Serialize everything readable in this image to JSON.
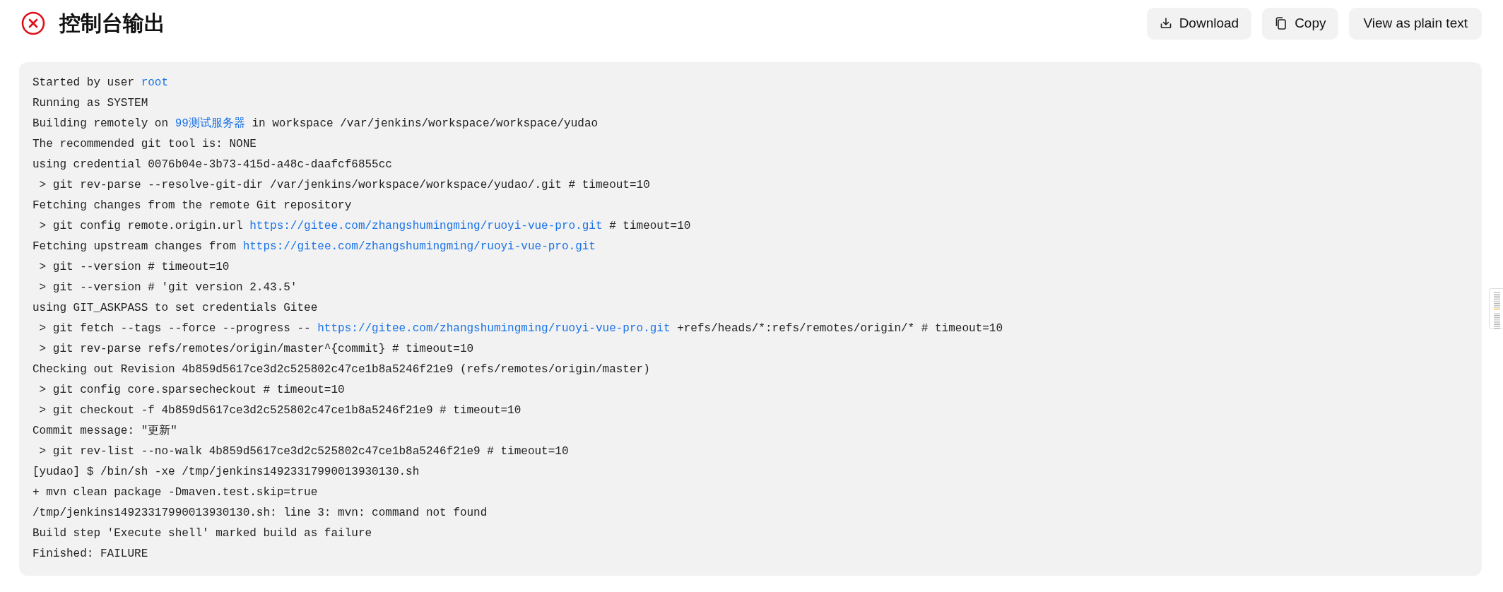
{
  "header": {
    "failed": true,
    "title": "控制台输出"
  },
  "buttons": [
    {
      "kind": "download",
      "label": "Download"
    },
    {
      "kind": "copy",
      "label": "Copy"
    },
    {
      "kind": "plain",
      "label": "View as plain text"
    }
  ],
  "log": [
    [
      {
        "kind": "text",
        "text": "Started by user "
      },
      {
        "kind": "link",
        "text": "root"
      }
    ],
    [
      {
        "kind": "text",
        "text": "Running as SYSTEM"
      }
    ],
    [
      {
        "kind": "text",
        "text": "Building remotely on "
      },
      {
        "kind": "link",
        "text": "99测试服务器"
      },
      {
        "kind": "text",
        "text": " in workspace /var/jenkins/workspace/workspace/yudao"
      }
    ],
    [
      {
        "kind": "text",
        "text": "The recommended git tool is: NONE"
      }
    ],
    [
      {
        "kind": "text",
        "text": "using credential 0076b04e-3b73-415d-a48c-daafcf6855cc"
      }
    ],
    [
      {
        "kind": "text",
        "text": " > git rev-parse --resolve-git-dir /var/jenkins/workspace/workspace/yudao/.git # timeout=10"
      }
    ],
    [
      {
        "kind": "text",
        "text": "Fetching changes from the remote Git repository"
      }
    ],
    [
      {
        "kind": "text",
        "text": " > git config remote.origin.url "
      },
      {
        "kind": "link",
        "text": "https://gitee.com/zhangshumingming/ruoyi-vue-pro.git"
      },
      {
        "kind": "text",
        "text": " # timeout=10"
      }
    ],
    [
      {
        "kind": "text",
        "text": "Fetching upstream changes from "
      },
      {
        "kind": "link",
        "text": "https://gitee.com/zhangshumingming/ruoyi-vue-pro.git"
      }
    ],
    [
      {
        "kind": "text",
        "text": " > git --version # timeout=10"
      }
    ],
    [
      {
        "kind": "text",
        "text": " > git --version # 'git version 2.43.5'"
      }
    ],
    [
      {
        "kind": "text",
        "text": "using GIT_ASKPASS to set credentials Gitee"
      }
    ],
    [
      {
        "kind": "text",
        "text": " > git fetch --tags --force --progress -- "
      },
      {
        "kind": "link",
        "text": "https://gitee.com/zhangshumingming/ruoyi-vue-pro.git"
      },
      {
        "kind": "text",
        "text": " +refs/heads/*:refs/remotes/origin/* # timeout=10"
      }
    ],
    [
      {
        "kind": "text",
        "text": " > git rev-parse refs/remotes/origin/master^{commit} # timeout=10"
      }
    ],
    [
      {
        "kind": "text",
        "text": "Checking out Revision 4b859d5617ce3d2c525802c47ce1b8a5246f21e9 (refs/remotes/origin/master)"
      }
    ],
    [
      {
        "kind": "text",
        "text": " > git config core.sparsecheckout # timeout=10"
      }
    ],
    [
      {
        "kind": "text",
        "text": " > git checkout -f 4b859d5617ce3d2c525802c47ce1b8a5246f21e9 # timeout=10"
      }
    ],
    [
      {
        "kind": "text",
        "text": "Commit message: \"更新\""
      }
    ],
    [
      {
        "kind": "text",
        "text": " > git rev-list --no-walk 4b859d5617ce3d2c525802c47ce1b8a5246f21e9 # timeout=10"
      }
    ],
    [
      {
        "kind": "text",
        "text": "[yudao] $ /bin/sh -xe /tmp/jenkins14923317990013930130.sh"
      }
    ],
    [
      {
        "kind": "text",
        "text": "+ mvn clean package -Dmaven.test.skip=true"
      }
    ],
    [
      {
        "kind": "text",
        "text": "/tmp/jenkins14923317990013930130.sh: line 3: mvn: command not found"
      }
    ],
    [
      {
        "kind": "text",
        "text": "Build step 'Execute shell' marked build as failure"
      }
    ],
    [
      {
        "kind": "text",
        "text": "Finished: FAILURE"
      }
    ]
  ]
}
